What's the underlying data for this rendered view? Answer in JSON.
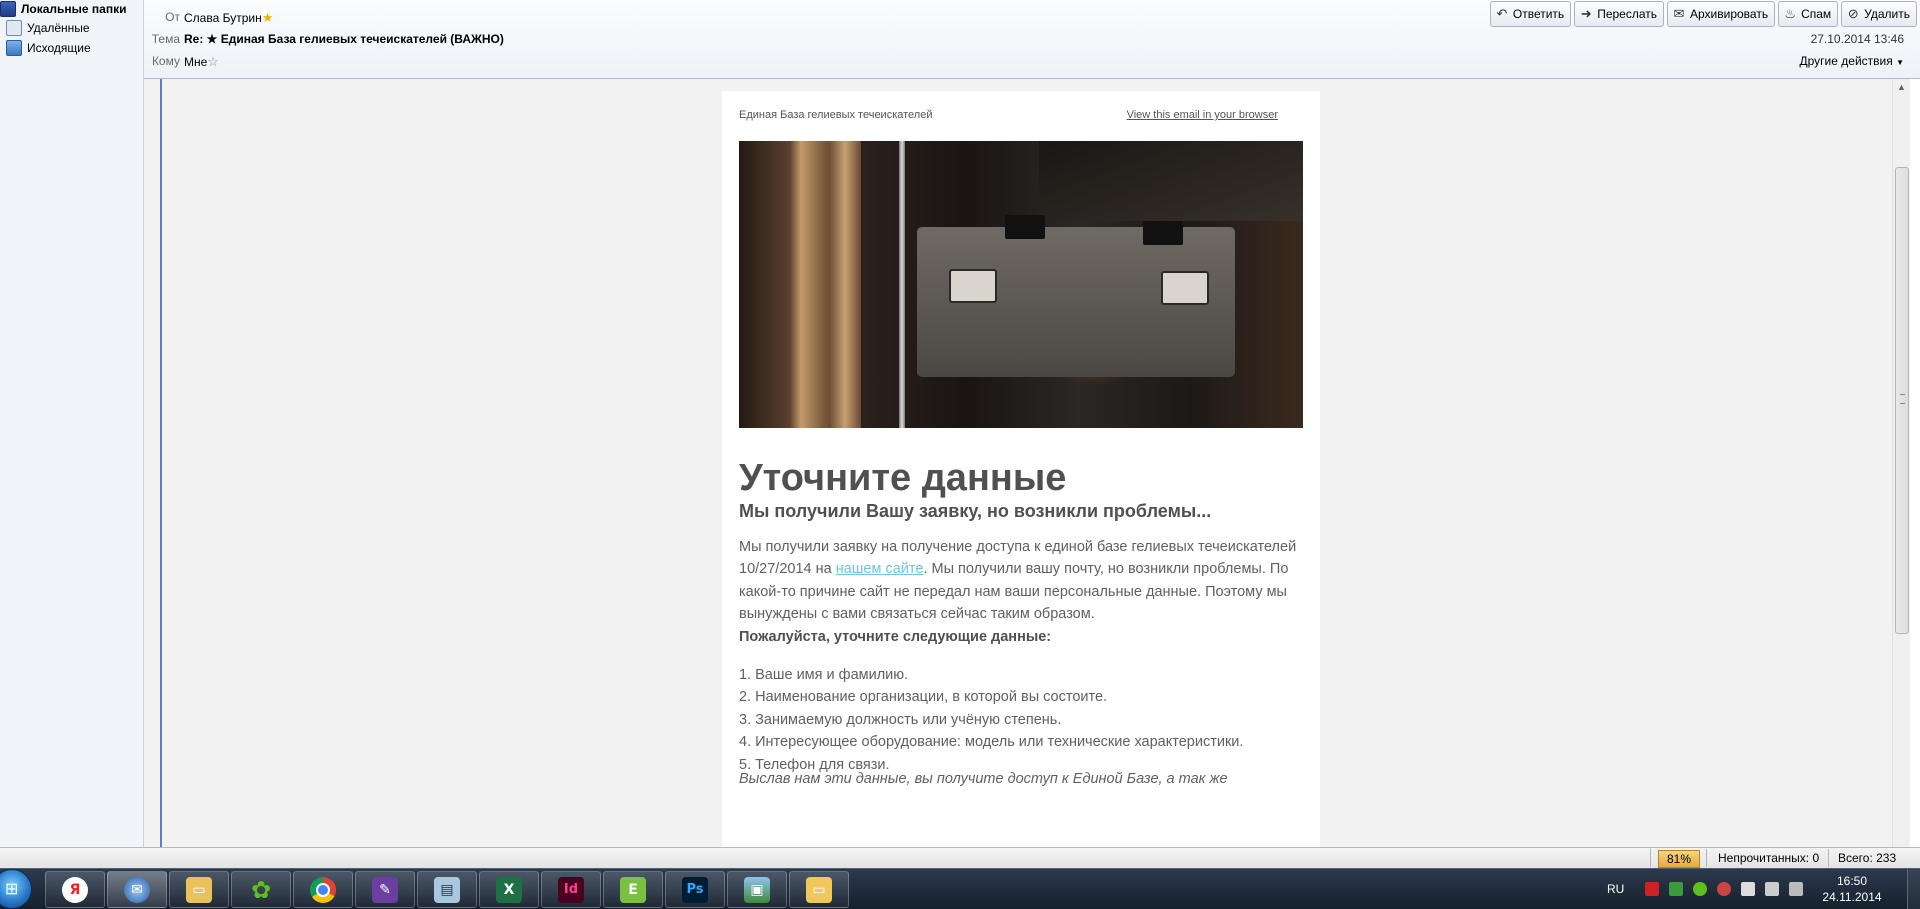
{
  "folders": {
    "root_label": "Локальные папки",
    "items": [
      {
        "label": "Удалённые"
      },
      {
        "label": "Исходящие"
      }
    ]
  },
  "header": {
    "from_label": "От",
    "from_value": "Слава Бутрин",
    "subject_label": "Тема",
    "subject_value": "Re: ★ Единая База гелиевых течеискателей (ВАЖНО)",
    "to_label": "Кому",
    "to_value": "Мне",
    "date": "27.10.2014 13:46",
    "other_actions": "Другие действия",
    "toolbar": {
      "reply": "Ответить",
      "forward": "Переслать",
      "archive": "Архивировать",
      "spam": "Спам",
      "delete": "Удалить"
    }
  },
  "email": {
    "preheader": "Единая База гелиевых течеискателей",
    "view_in_browser": "View this email in your browser",
    "title": "Уточните данные",
    "subtitle": "Мы получили Вашу заявку, но возникли проблемы...",
    "para1_before_link": "Мы получили заявку на получение доступа к единой базе гелиевых течеискателей 10/27/2014 на ",
    "para1_link": "нашем сайте",
    "para1_after_link": ". Мы получили вашу почту, но возникли проблемы. По какой-то причине сайт не передал нам ваши персональные данные. Поэтому мы вынуждены с вами связаться сейчас таким образом.",
    "request_heading": "Пожалуйста, уточните следующие данные:",
    "list": [
      "1. Ваше имя и фамилию.",
      "2. Наименование организации, в которой вы состоите.",
      "3. Занимаемую должность или учёную степень.",
      "4. Интересующее оборудование: модель или технические характеристики.",
      "5. Телефон для связи."
    ],
    "closing_partial": "Выслав нам эти данные, вы получите доступ к Единой Базе, а так же"
  },
  "status": {
    "zoom": "81%",
    "unread": "Непрочитанных: 0",
    "total": "Всего: 233"
  },
  "taskbar": {
    "lang": "RU",
    "time": "16:50",
    "date": "24.11.2014",
    "apps": [
      "yandex-browser",
      "thunderbird",
      "file-explorer",
      "icq",
      "chrome",
      "pen-app",
      "notepad-app",
      "excel",
      "indesign",
      "evernote",
      "photoshop",
      "image-viewer",
      "folder"
    ]
  },
  "colors": {
    "link": "#6dc6dd",
    "body_text": "#606060",
    "heading_text": "#505050",
    "zoom_badge": "#e4aa3a",
    "blue_rule": "#5b82c4"
  }
}
